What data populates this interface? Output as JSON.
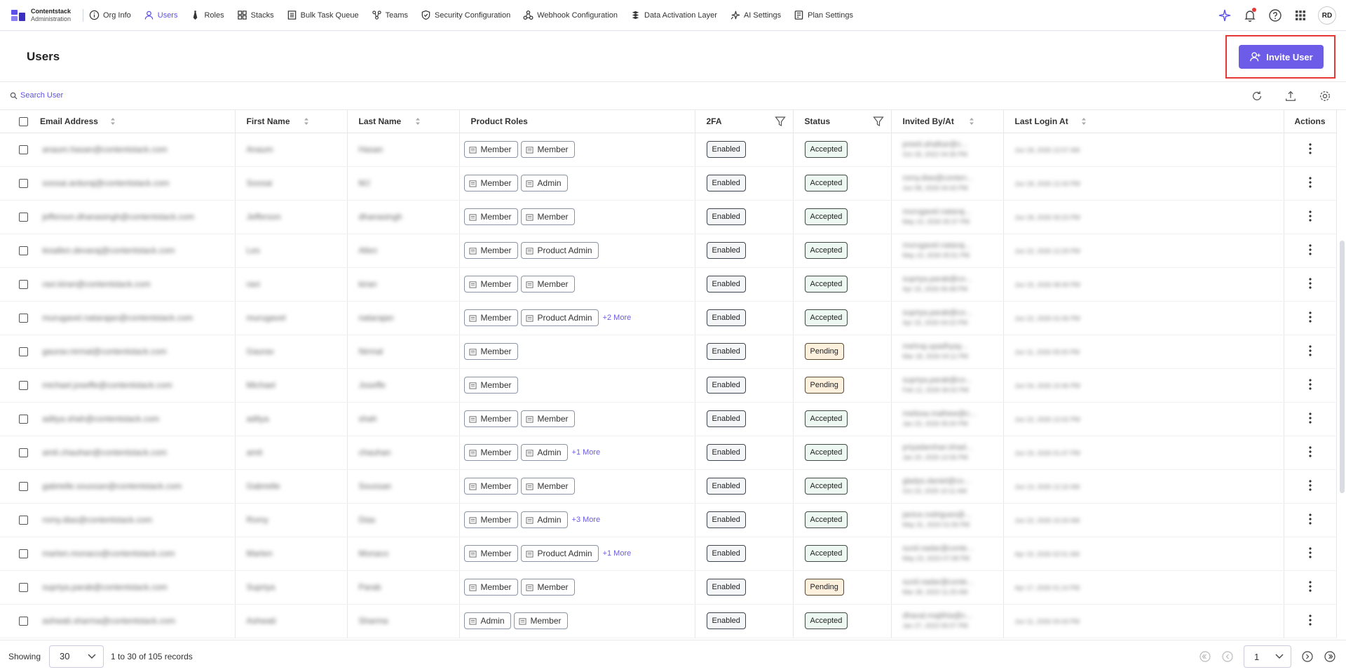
{
  "brand": {
    "line1": "Contentstack",
    "line2": "Administration"
  },
  "nav": [
    {
      "label": "Org Info",
      "icon": "info-icon",
      "active": false
    },
    {
      "label": "Users",
      "icon": "user-icon",
      "active": true
    },
    {
      "label": "Roles",
      "icon": "tie-icon",
      "active": false
    },
    {
      "label": "Stacks",
      "icon": "grid-icon",
      "active": false
    },
    {
      "label": "Bulk Task Queue",
      "icon": "list-icon",
      "active": false
    },
    {
      "label": "Teams",
      "icon": "teams-icon",
      "active": false
    },
    {
      "label": "Security Configuration",
      "icon": "shield-icon",
      "active": false
    },
    {
      "label": "Webhook Configuration",
      "icon": "webhook-icon",
      "active": false
    },
    {
      "label": "Data Activation Layer",
      "icon": "layers-icon",
      "active": false
    },
    {
      "label": "AI Settings",
      "icon": "sparkle-icon",
      "active": false
    },
    {
      "label": "Plan Settings",
      "icon": "plan-icon",
      "active": false
    }
  ],
  "user": {
    "initials": "RD"
  },
  "page": {
    "title": "Users",
    "invite_label": "Invite User"
  },
  "search": {
    "placeholder": "Search User"
  },
  "columns": [
    "Email Address",
    "First Name",
    "Last Name",
    "Product Roles",
    "2FA",
    "Status",
    "Invited By/At",
    "Last Login At",
    "Actions"
  ],
  "rows": [
    {
      "email": "anaum.hasan@contentstack.com",
      "first": "Anaum",
      "last": "Hasan",
      "roles": [
        "Member",
        "Member"
      ],
      "more": "",
      "twofa": "Enabled",
      "status": "Accepted",
      "inviter": "preeti.ahalkar@c...",
      "invited_at": "Oct 18, 2022 04:36 PM",
      "last_login": "Jun 18, 2026 12:07 AM"
    },
    {
      "email": "soosai.arduraj@contentstack.com",
      "first": "Soosai",
      "last": "MJ",
      "roles": [
        "Member",
        "Admin"
      ],
      "more": "",
      "twofa": "Enabled",
      "status": "Accepted",
      "inviter": "romy.dias@conten...",
      "invited_at": "Jun 08, 2026 04:43 PM",
      "last_login": "Jun 18, 2026 12:43 PM"
    },
    {
      "email": "jefferson.dhanasingh@contentstack.com",
      "first": "Jefferson",
      "last": "dhanasingh",
      "roles": [
        "Member",
        "Member"
      ],
      "more": "",
      "twofa": "Enabled",
      "status": "Accepted",
      "inviter": "murugavel.nataraj...",
      "invited_at": "May 14, 2026 05:37 PM",
      "last_login": "Jun 18, 2026 06:23 PM"
    },
    {
      "email": "lesallen.devaraj@contentstack.com",
      "first": "Les",
      "last": "Allen",
      "roles": [
        "Member",
        "Product Admin"
      ],
      "more": "",
      "twofa": "Enabled",
      "status": "Accepted",
      "inviter": "murugavel.nataraj...",
      "invited_at": "May 14, 2026 05:51 PM",
      "last_login": "Jun 22, 2026 12:29 PM"
    },
    {
      "email": "ravi.kiran@contentstack.com",
      "first": "ravi",
      "last": "kiran",
      "roles": [
        "Member",
        "Member"
      ],
      "more": "",
      "twofa": "Enabled",
      "status": "Accepted",
      "inviter": "supriya.parab@co...",
      "invited_at": "Apr 15, 2026 06:48 PM",
      "last_login": "Jun 15, 2026 08:49 PM"
    },
    {
      "email": "murugavel.natarajan@contentstack.com",
      "first": "murugavel",
      "last": "natarajan",
      "roles": [
        "Member",
        "Product Admin"
      ],
      "more": "+2 More",
      "twofa": "Enabled",
      "status": "Accepted",
      "inviter": "supriya.parab@co...",
      "invited_at": "Apr 15, 2026 04:22 PM",
      "last_login": "Jun 22, 2026 01:06 PM"
    },
    {
      "email": "gaurav.nirmal@contentstack.com",
      "first": "Gaurav",
      "last": "Nirmal",
      "roles": [
        "Member"
      ],
      "more": "",
      "twofa": "Enabled",
      "status": "Pending",
      "inviter": "mehraj.upadhyay...",
      "invited_at": "Mar 18, 2026 04:11 PM",
      "last_login": "Jun 11, 2026 05:00 PM"
    },
    {
      "email": "michael.joseffe@contentstack.com",
      "first": "Michael",
      "last": "Joseffe",
      "roles": [
        "Member"
      ],
      "more": "",
      "twofa": "Enabled",
      "status": "Pending",
      "inviter": "supriya.parab@co...",
      "invited_at": "Feb 12, 2026 06:02 PM",
      "last_login": "Jun 04, 2026 10:46 PM"
    },
    {
      "email": "aditya.shah@contentstack.com",
      "first": "aditya",
      "last": "shah",
      "roles": [
        "Member",
        "Member"
      ],
      "more": "",
      "twofa": "Enabled",
      "status": "Accepted",
      "inviter": "melissa.mathew@c...",
      "invited_at": "Jan 23, 2026 05:00 PM",
      "last_login": "Jun 22, 2026 12:02 PM"
    },
    {
      "email": "amit.chauhan@contentstack.com",
      "first": "amit",
      "last": "chauhan",
      "roles": [
        "Member",
        "Admin"
      ],
      "more": "+1 More",
      "twofa": "Enabled",
      "status": "Accepted",
      "inviter": "priyadarshan.khad...",
      "invited_at": "Jan 20, 2026 12:06 PM",
      "last_login": "Jun 19, 2026 01:47 PM"
    },
    {
      "email": "gabrielle.soussan@contentstack.com",
      "first": "Gabrielle",
      "last": "Soussan",
      "roles": [
        "Member",
        "Member"
      ],
      "more": "",
      "twofa": "Enabled",
      "status": "Accepted",
      "inviter": "gladys.daniel@co...",
      "invited_at": "Oct 23, 2025 10:11 AM",
      "last_login": "Jun 13, 2026 12:16 AM"
    },
    {
      "email": "romy.dias@contentstack.com",
      "first": "Romy",
      "last": "Dias",
      "roles": [
        "Member",
        "Admin"
      ],
      "more": "+3 More",
      "twofa": "Enabled",
      "status": "Accepted",
      "inviter": "janice.rodrigues@...",
      "invited_at": "May 31, 2024 01:06 PM",
      "last_login": "Jun 22, 2026 10:24 AM"
    },
    {
      "email": "marten.monaco@contentstack.com",
      "first": "Marten",
      "last": "Monaco",
      "roles": [
        "Member",
        "Product Admin"
      ],
      "more": "+1 More",
      "twofa": "Enabled",
      "status": "Accepted",
      "inviter": "sunil.nadar@conte...",
      "invited_at": "May 23, 2023 07:08 PM",
      "last_login": "Apr 19, 2026 02:01 AM"
    },
    {
      "email": "supriya.parab@contentstack.com",
      "first": "Supriya",
      "last": "Parab",
      "roles": [
        "Member",
        "Member"
      ],
      "more": "",
      "twofa": "Enabled",
      "status": "Pending",
      "inviter": "sunil.nadar@conte...",
      "invited_at": "Mar 28, 2023 11:25 AM",
      "last_login": "Apr 17, 2026 01:14 PM"
    },
    {
      "email": "ashwati.sharma@contentstack.com",
      "first": "Ashwati",
      "last": "Sharma",
      "roles": [
        "Admin",
        "Member"
      ],
      "more": "",
      "twofa": "Enabled",
      "status": "Accepted",
      "inviter": "dhaval.majithia@c...",
      "invited_at": "Jan 27, 2023 05:07 PM",
      "last_login": "Jun 11, 2026 04:43 PM"
    }
  ],
  "footer": {
    "showing_label": "Showing",
    "page_size": "30",
    "records_text": "1 to 30 of 105 records",
    "current_page": "1"
  },
  "colors": {
    "accent": "#6c5ce7",
    "highlight": "#e53935"
  }
}
